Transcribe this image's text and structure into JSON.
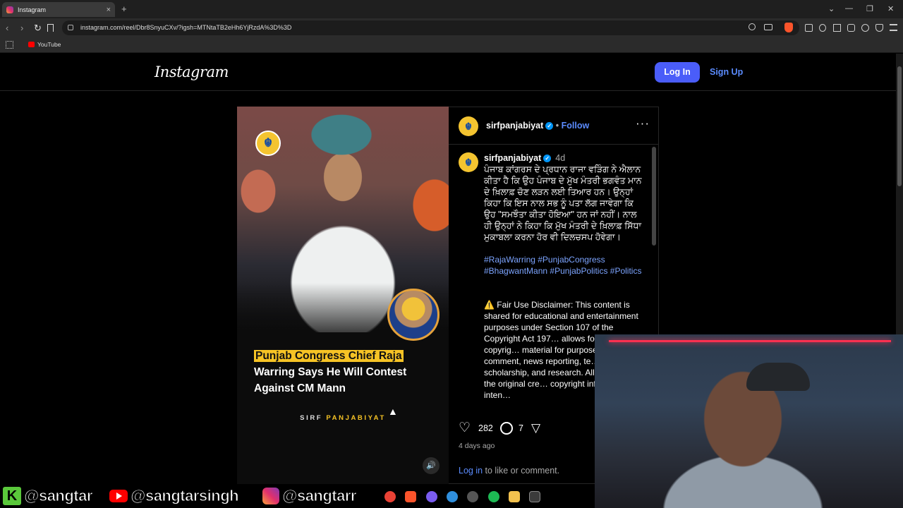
{
  "browser": {
    "tab_title": "Instagram",
    "new_tab": "+",
    "url": "instagram.com/reel/Dbr8SnyuCXv/?igsh=MTNtaTB2eHh6YjRzdA%3D%3D",
    "bookmark_youtube": "YouTube",
    "tab_close": "×",
    "back": "‹",
    "forward": "›",
    "reload": "↻",
    "win_min": "—",
    "win_restore": "❐",
    "win_close": "✕",
    "tab_dropdown": "⌄"
  },
  "instagram": {
    "logo": "Instagram",
    "login_button": "Log In",
    "signup_link": "Sign Up"
  },
  "reel": {
    "headline_highlight": "Punjab Congress Chief Raja",
    "headline_rest": "Warring Says He Will Contest Against CM Mann",
    "brand_left": "SIRF ",
    "brand_right": "PANJABIYAT",
    "mute_icon": "🔊"
  },
  "post": {
    "username": "sirfpanjabiyat",
    "verified_mark": "✓",
    "follow_sep": " • ",
    "follow": "Follow",
    "more": "···",
    "caption_user": "sirfpanjabiyat",
    "caption_time": "4d",
    "caption_text": "ਪੰਜਾਬ ਕਾਂਗਰਸ ਦੇ ਪ੍ਰਧਾਨ ਰਾਜਾ ਵੜਿੰਗ ਨੇ ਐਲਾਨ ਕੀਤਾ ਹੈ ਕਿ ਉਹ ਪੰਜਾਬ ਦੇ ਮੁੱਖ ਮੰਤਰੀ ਭਗਵੰਤ ਮਾਨ ਦੇ ਖ਼ਿਲਾਫ਼ ਚੋਣ ਲੜਨ ਲਈ ਤਿਆਰ ਹਨ। ਉਨ੍ਹਾਂ ਕਿਹਾ ਕਿ ਇਸ ਨਾਲ ਸਭ ਨੂੰ ਪਤਾ ਲੱਗ ਜਾਵੇਗਾ ਕਿ ਉਹ \"ਸਮਝੌਤਾ ਕੀਤਾ ਹੋਇਆ\" ਹਨ ਜਾਂ ਨਹੀਂ। ਨਾਲ ਹੀ ਉਨ੍ਹਾਂ ਨੇ ਕਿਹਾ ਕਿ ਮੁੱਖ ਮੰਤਰੀ ਦੇ ਖ਼ਿਲਾਫ਼ ਸਿੱਧਾ ਮੁਕਾਬਲਾ ਕਰਨਾ ਹੋਰ ਵੀ ਦਿਲਚਸਪ ਹੋਵੇਗਾ।",
    "hashtags": "#RajaWarring #PunjabCongress #BhagwantMann #PunjabPolitics #Politics",
    "disclaimer_icon": "⚠️",
    "disclaimer": "Fair Use Disclaimer: This content is shared for educational and entertainment purposes under Section 107 of the Copyright Act 197… allows for fair use of copyrig… material for purposes such a… comment, news reporting, te… scholarship, and research. All credits go to the original cre… copyright infringement inten…",
    "likes": "282",
    "comments": "7",
    "posted": "4 days ago",
    "login_prompt_link": "Log in",
    "login_prompt_rest": " to like or comment."
  },
  "streamer": {
    "kick_letter": "K",
    "kick_handle": "@sangtar",
    "youtube_handle": "@sangtarsingh",
    "instagram_handle": "@sangtarr"
  },
  "colors": {
    "accent_blue": "#4a5df9",
    "link_blue": "#5b8cff",
    "headline_yellow": "#f6c325"
  }
}
